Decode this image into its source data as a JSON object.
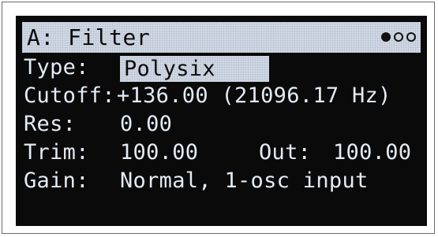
{
  "header": {
    "title": "A: Filter",
    "page_indicator": {
      "total": 3,
      "active": 1
    }
  },
  "params": {
    "type_label": "Type:",
    "type_value": "Polysix",
    "cutoff_label": "Cutoff:",
    "cutoff_value": "+136.00 (21096.17 Hz)",
    "res_label": "Res:",
    "res_value": "0.00",
    "trim_label": "Trim:",
    "trim_value": "100.00",
    "out_label": "Out:",
    "out_value": "100.00",
    "gain_label": "Gain:",
    "gain_value": "Normal, 1-osc input"
  }
}
